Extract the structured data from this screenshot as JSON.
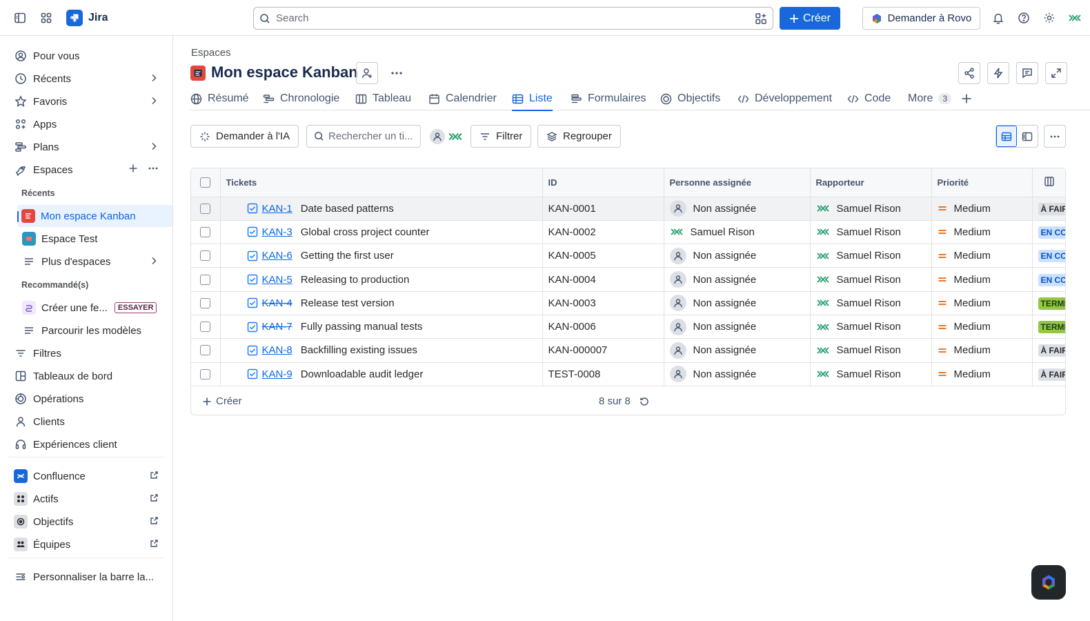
{
  "app": {
    "name": "Jira",
    "brand_color": "#1868DB"
  },
  "topbar": {
    "search_placeholder": "Search",
    "create_label": "Créer",
    "rovo_label": "Demander à Rovo"
  },
  "sidebar": {
    "items": [
      {
        "label": "Pour vous",
        "icon": "user-circle-icon"
      },
      {
        "label": "Récents",
        "icon": "clock-icon"
      },
      {
        "label": "Favoris",
        "icon": "star-icon"
      },
      {
        "label": "Apps",
        "icon": "apps-icon"
      },
      {
        "label": "Plans",
        "icon": "plans-icon"
      },
      {
        "label": "Espaces",
        "icon": "spaces-icon"
      }
    ],
    "recent_label": "Récents",
    "spaces": [
      {
        "label": "Mon espace Kanban"
      },
      {
        "label": "Espace Test"
      },
      {
        "label": "Plus d'espaces"
      }
    ],
    "recommended_label": "Recommandé(s)",
    "recommended": [
      {
        "label": "Créer une fe...",
        "badge": "ESSAYER"
      },
      {
        "label": "Parcourir les modèles"
      }
    ],
    "more_items": [
      {
        "label": "Filtres"
      },
      {
        "label": "Tableaux de bord"
      },
      {
        "label": "Opérations"
      },
      {
        "label": "Clients"
      },
      {
        "label": "Expériences client"
      }
    ],
    "apps": [
      {
        "label": "Confluence"
      },
      {
        "label": "Actifs"
      },
      {
        "label": "Objectifs"
      },
      {
        "label": "Équipes"
      }
    ],
    "customize_label": "Personnaliser la barre la..."
  },
  "main": {
    "breadcrumb": "Espaces",
    "project_title": "Mon espace Kanban",
    "tabs": [
      {
        "label": "Résumé"
      },
      {
        "label": "Chronologie"
      },
      {
        "label": "Tableau"
      },
      {
        "label": "Calendrier"
      },
      {
        "label": "Liste"
      },
      {
        "label": "Formulaires"
      },
      {
        "label": "Objectifs"
      },
      {
        "label": "Développement"
      },
      {
        "label": "Code"
      },
      {
        "label": "More",
        "count": "3"
      }
    ],
    "toolbar": {
      "ask_ai_label": "Demander à l'IA",
      "search_placeholder": "Rechercher un ti...",
      "filter_label": "Filtrer",
      "group_label": "Regrouper"
    }
  },
  "table": {
    "columns": [
      "Tickets",
      "ID",
      "Personne assignée",
      "Rapporteur",
      "Priorité"
    ],
    "rows": [
      {
        "key": "KAN-1",
        "summary": "Date based patterns",
        "id": "KAN-0001",
        "assignee": "Non assignée",
        "reporter": "Samuel Rison",
        "priority": "Medium",
        "status": "À FAIRE",
        "done": false
      },
      {
        "key": "KAN-3",
        "summary": "Global cross project counter",
        "id": "KAN-0002",
        "assignee": "Samuel Rison",
        "reporter": "Samuel Rison",
        "priority": "Medium",
        "status": "EN COURS",
        "done": false
      },
      {
        "key": "KAN-6",
        "summary": "Getting the first user",
        "id": "KAN-0005",
        "assignee": "Non assignée",
        "reporter": "Samuel Rison",
        "priority": "Medium",
        "status": "EN COURS",
        "done": false
      },
      {
        "key": "KAN-5",
        "summary": "Releasing to production",
        "id": "KAN-0004",
        "assignee": "Non assignée",
        "reporter": "Samuel Rison",
        "priority": "Medium",
        "status": "EN COURS",
        "done": false
      },
      {
        "key": "KAN-4",
        "summary": "Release test version",
        "id": "KAN-0003",
        "assignee": "Non assignée",
        "reporter": "Samuel Rison",
        "priority": "Medium",
        "status": "TERMINÉ",
        "done": true
      },
      {
        "key": "KAN-7",
        "summary": "Fully passing manual tests",
        "id": "KAN-0006",
        "assignee": "Non assignée",
        "reporter": "Samuel Rison",
        "priority": "Medium",
        "status": "TERMINÉ",
        "done": true
      },
      {
        "key": "KAN-8",
        "summary": "Backfilling existing issues",
        "id": "KAN-000007",
        "assignee": "Non assignée",
        "reporter": "Samuel Rison",
        "priority": "Medium",
        "status": "À FAIRE",
        "done": false
      },
      {
        "key": "KAN-9",
        "summary": "Downloadable audit ledger",
        "id": "TEST-0008",
        "assignee": "Non assignée",
        "reporter": "Samuel Rison",
        "priority": "Medium",
        "status": "À FAIRE",
        "done": false
      }
    ],
    "footer_create": "Créer",
    "footer_count": "8 sur 8"
  },
  "colors": {
    "link": "#0C66E4",
    "priority_medium": "#E56910",
    "reporter_icon": "#22A06B"
  }
}
